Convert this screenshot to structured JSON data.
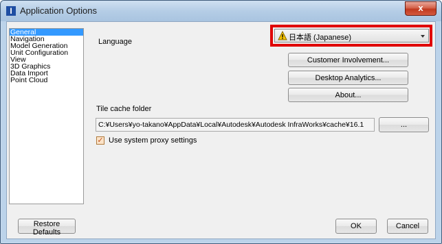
{
  "window": {
    "title": "Application Options",
    "close_glyph": "x"
  },
  "nav": {
    "items": [
      {
        "label": "General",
        "selected": true
      },
      {
        "label": "Navigation"
      },
      {
        "label": "Model Generation"
      },
      {
        "label": "Unit Configuration"
      },
      {
        "label": "View"
      },
      {
        "label": "3D Graphics"
      },
      {
        "label": "Data Import"
      },
      {
        "label": "Point Cloud"
      }
    ]
  },
  "general": {
    "language_label": "Language",
    "language_value": "日本語 (Japanese)",
    "customer_involvement_button": "Customer Involvement...",
    "desktop_analytics_button": "Desktop Analytics...",
    "about_button": "About...",
    "tile_cache_label": "Tile cache folder",
    "tile_cache_path": "C:¥Users¥yo-takano¥AppData¥Local¥Autodesk¥Autodesk InfraWorks¥cache¥16.1",
    "browse_button": "...",
    "proxy_checkbox_label": "Use system proxy settings",
    "proxy_checked": true
  },
  "footer": {
    "restore_defaults_button": "Restore Defaults",
    "ok_button": "OK",
    "cancel_button": "Cancel"
  },
  "colors": {
    "highlight_border": "#e00000",
    "selected_nav": "#3399ff",
    "warning": "#f5c400"
  },
  "icons": [
    "app-icon",
    "close-icon",
    "warning-icon",
    "chevron-down-icon",
    "checkmark-icon"
  ]
}
